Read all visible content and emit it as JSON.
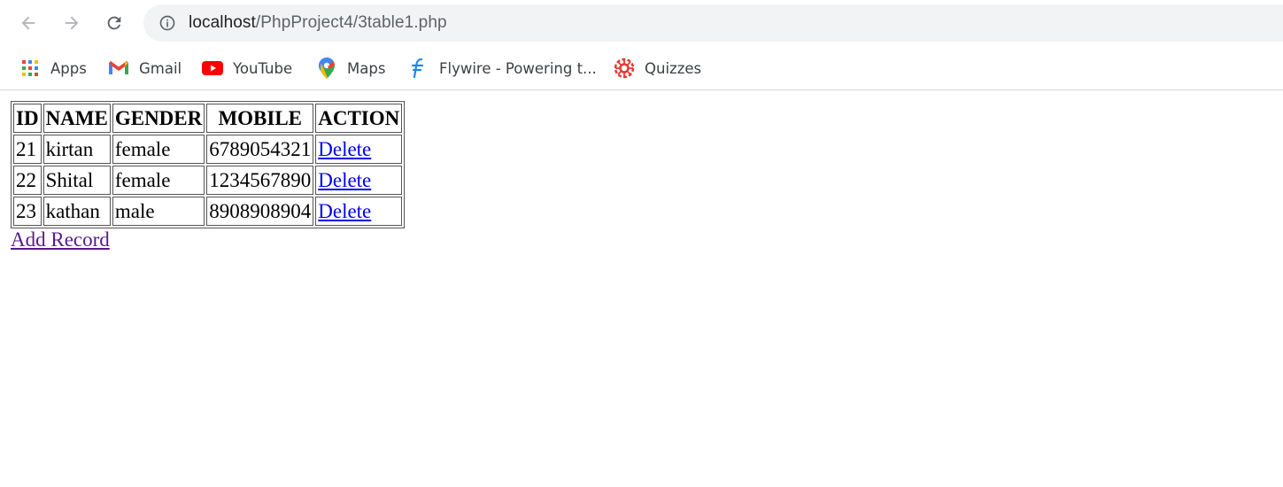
{
  "browser": {
    "url_host": "localhost",
    "url_path": "/PhpProject4/3table1.php",
    "bookmarks": [
      {
        "label": "Apps",
        "icon": "apps-grid-icon"
      },
      {
        "label": "Gmail",
        "icon": "gmail-icon"
      },
      {
        "label": "YouTube",
        "icon": "youtube-icon"
      },
      {
        "label": "Maps",
        "icon": "maps-pin-icon"
      },
      {
        "label": "Flywire - Powering t...",
        "icon": "flywire-icon"
      },
      {
        "label": "Quizzes",
        "icon": "quizzes-icon"
      }
    ]
  },
  "table": {
    "headers": [
      "ID",
      "NAME",
      "GENDER",
      "MOBILE",
      "ACTION"
    ],
    "rows": [
      {
        "id": "21",
        "name": "kirtan",
        "gender": "female",
        "mobile": "6789054321",
        "action": "Delete"
      },
      {
        "id": "22",
        "name": "Shital",
        "gender": "female",
        "mobile": "1234567890",
        "action": "Delete"
      },
      {
        "id": "23",
        "name": "kathan",
        "gender": "male",
        "mobile": "8908908904",
        "action": "Delete"
      }
    ]
  },
  "add_record_label": "Add Record",
  "colors": {
    "link": "#0000ee",
    "visited_link": "#551a8b",
    "omnibox_bg": "#f1f3f4"
  }
}
